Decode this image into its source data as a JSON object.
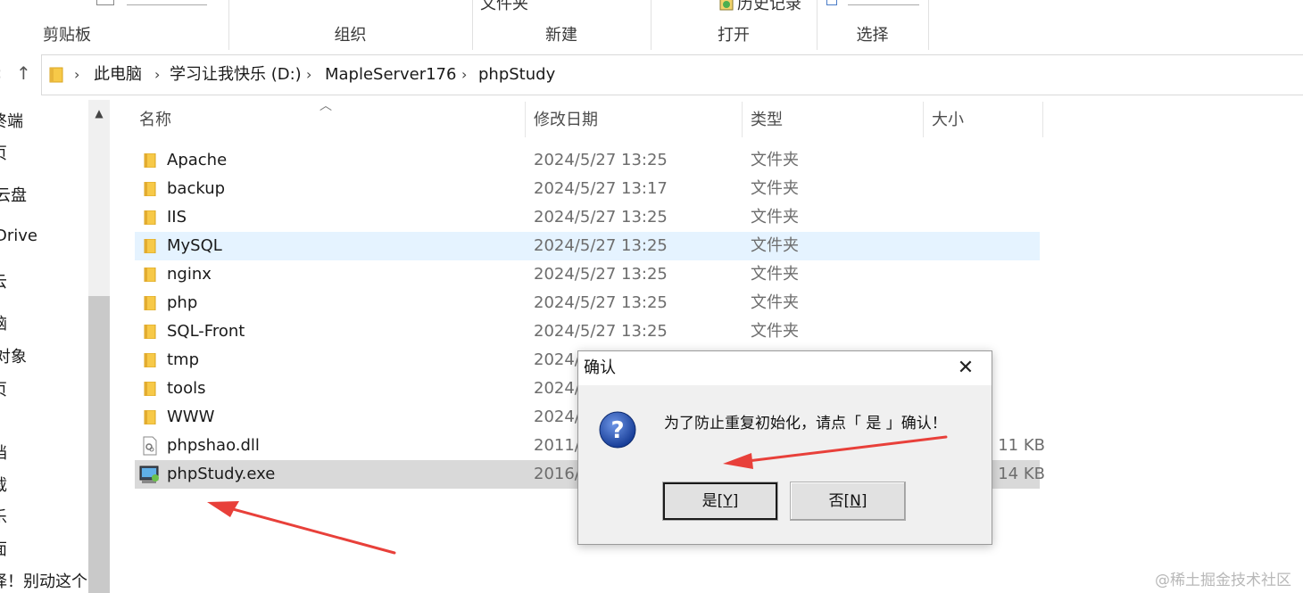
{
  "ribbon": {
    "groups": [
      "剪贴板",
      "组织",
      "新建",
      "打开",
      "选择"
    ],
    "cut_new_folder": "文件夹",
    "cut_history": "历史记录"
  },
  "nav": {
    "back": "‹",
    "up": "↑"
  },
  "address": {
    "crumbs": [
      "此电脑",
      "学习让我快乐 (D:)",
      "MapleServer176",
      "phpStudy"
    ]
  },
  "navpane": {
    "items": [
      "终端",
      "页",
      "云盘",
      "Drive",
      "云",
      "脑",
      "对象",
      "页",
      "",
      "档",
      "载",
      "乐",
      "面",
      "择！别动这个"
    ]
  },
  "columns": {
    "name": "名称",
    "date": "修改日期",
    "type": "类型",
    "size": "大小"
  },
  "files": [
    {
      "name": "Apache",
      "date": "2024/5/27 13:25",
      "type": "文件夹",
      "size": "",
      "icon": "folder-icon"
    },
    {
      "name": "backup",
      "date": "2024/5/27 13:17",
      "type": "文件夹",
      "size": "",
      "icon": "folder-icon"
    },
    {
      "name": "IIS",
      "date": "2024/5/27 13:25",
      "type": "文件夹",
      "size": "",
      "icon": "folder-icon"
    },
    {
      "name": "MySQL",
      "date": "2024/5/27 13:25",
      "type": "文件夹",
      "size": "",
      "icon": "folder-icon"
    },
    {
      "name": "nginx",
      "date": "2024/5/27 13:25",
      "type": "文件夹",
      "size": "",
      "icon": "folder-icon"
    },
    {
      "name": "php",
      "date": "2024/5/27 13:25",
      "type": "文件夹",
      "size": "",
      "icon": "folder-icon"
    },
    {
      "name": "SQL-Front",
      "date": "2024/5/27 13:25",
      "type": "文件夹",
      "size": "",
      "icon": "folder-icon"
    },
    {
      "name": "tmp",
      "date": "2024/",
      "type": "",
      "size": "",
      "icon": "folder-icon"
    },
    {
      "name": "tools",
      "date": "2024/",
      "type": "",
      "size": "",
      "icon": "folder-icon"
    },
    {
      "name": "WWW",
      "date": "2024/",
      "type": "",
      "size": "",
      "icon": "folder-icon"
    },
    {
      "name": "phpshao.dll",
      "date": "2011/",
      "type": "",
      "size": "11 KB",
      "icon": "dll-file-icon"
    },
    {
      "name": "phpStudy.exe",
      "date": "2016/",
      "type": "",
      "size": "14 KB",
      "icon": "exe-app-icon"
    }
  ],
  "dialog": {
    "title": "确认",
    "close": "✕",
    "message": "为了防止重复初始化，请点「 是 」确认！",
    "yes_label": "是",
    "yes_key": "Y",
    "no_label": "否",
    "no_key": "N",
    "icon": "question-icon"
  },
  "watermark": "@稀土掘金技术社区",
  "colors": {
    "hover_row": "#e5f3ff",
    "selected_row": "#d9d9d9",
    "folder": "#f7c948",
    "annotation_arrow": "#e8403a",
    "question_icon": "#1f4fae"
  }
}
